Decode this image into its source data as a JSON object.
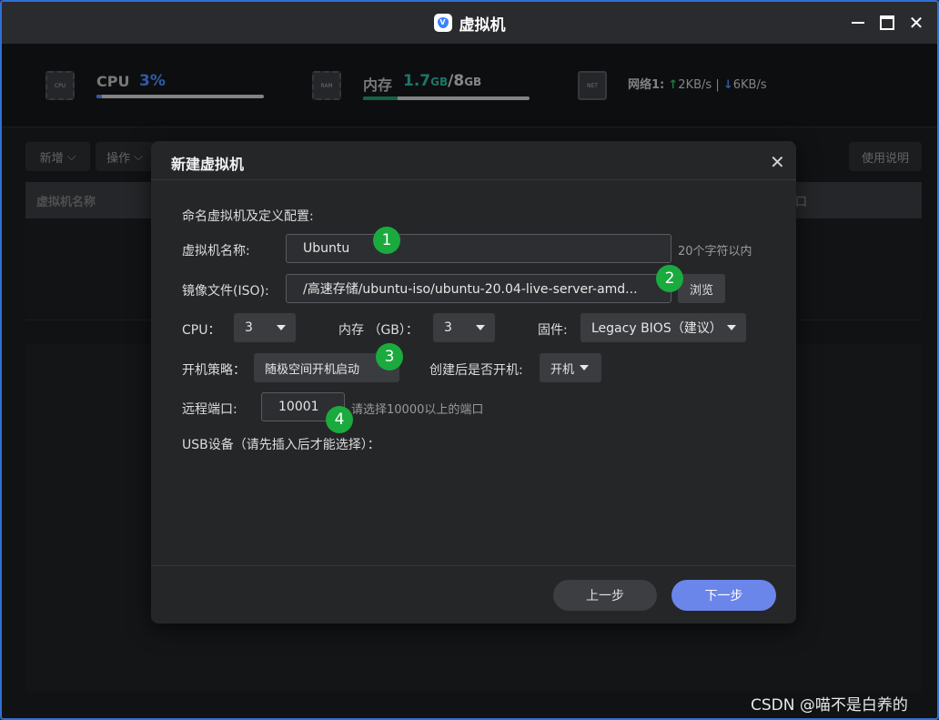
{
  "window": {
    "title": "虚拟机"
  },
  "stats": {
    "cpu": {
      "label": "CPU",
      "value": "3%",
      "progress": 0.03,
      "icon_text": "CPU"
    },
    "memory": {
      "label": "内存",
      "used": "1.7",
      "used_unit": "GB",
      "sep": "/",
      "total": "8",
      "total_unit": "GB",
      "progress": 0.21,
      "icon_text": "RAM"
    },
    "network": {
      "label": "网络1:",
      "up_arrow": "↑",
      "up": "2KB/s",
      "divider": "|",
      "down_arrow": "↓",
      "down": "6KB/s",
      "icon_text": "NET"
    }
  },
  "toolbar": {
    "add_label": "新增",
    "ops_label": "操作",
    "help_label": "使用说明"
  },
  "list": {
    "col_name": "虚拟机名称",
    "col_right": "口"
  },
  "dialog": {
    "title": "新建虚拟机",
    "section_label": "命名虚拟机及定义配置:",
    "vm_name_label": "虚拟机名称:",
    "vm_name_value": "Ubuntu",
    "vm_name_hint": "20个字符以内",
    "iso_label": "镜像文件(ISO):",
    "iso_value": "/高速存储/ubuntu-iso/ubuntu-20.04-live-server-amd...",
    "browse_label": "浏览",
    "cpu_label": "CPU：",
    "cpu_value": "3",
    "mem_label": "内存 （GB）：",
    "mem_value": "3",
    "firmware_label": "固件:",
    "firmware_value": "Legacy BIOS（建议）",
    "boot_policy_label": "开机策略：",
    "boot_policy_value": "随极空间开机启动",
    "power_on_label": "创建后是否开机:",
    "power_on_value": "开机",
    "remote_port_label": "远程端口:",
    "remote_port_value": "10001",
    "remote_port_hint": "请选择10000以上的端口",
    "usb_label": "USB设备（请先插入后才能选择）：",
    "prev_label": "上一步",
    "next_label": "下一步"
  },
  "annotations": [
    "1",
    "2",
    "3",
    "4"
  ],
  "watermark": "CSDN @喵不是白养的",
  "colors": {
    "accent_blue": "#6b86ea",
    "badge_green": "#1aaa3e",
    "cpu_value": "#4a8cff",
    "mem_value": "#2bb6a0"
  }
}
